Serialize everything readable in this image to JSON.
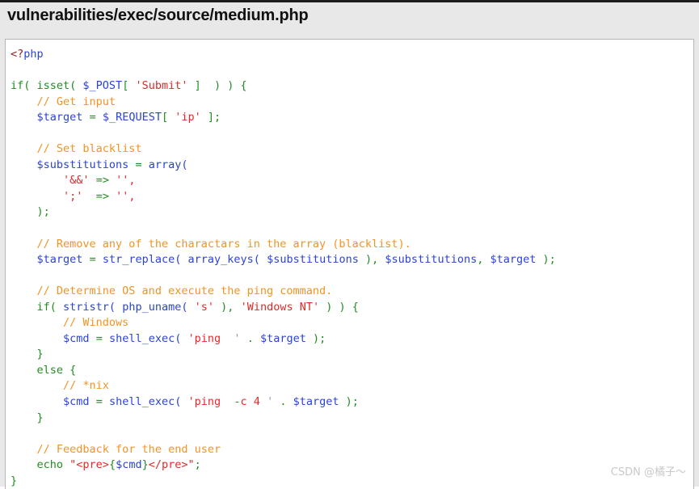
{
  "page": {
    "title": "vulnerabilities/exec/source/medium.php",
    "watermark": "CSDN @橘子～",
    "background_color": "#e8e8e8",
    "code_background_color": "#ffffff"
  },
  "colors": {
    "keyword": "#218c21",
    "variable": "#2b44d4",
    "function": "#2b44d4",
    "string": "#e02a2a",
    "comment": "#f39324",
    "tag": "#8a1f1f",
    "plain": "#333333"
  },
  "code": {
    "language": "php",
    "lines": [
      {
        "n": 1,
        "text": "<?php"
      },
      {
        "n": 2,
        "text": ""
      },
      {
        "n": 3,
        "text": "if( isset( $_POST[ 'Submit' ]  ) ) {"
      },
      {
        "n": 4,
        "text": "    // Get input"
      },
      {
        "n": 5,
        "text": "    $target = $_REQUEST[ 'ip' ];"
      },
      {
        "n": 6,
        "text": ""
      },
      {
        "n": 7,
        "text": "    // Set blacklist"
      },
      {
        "n": 8,
        "text": "    $substitutions = array("
      },
      {
        "n": 9,
        "text": "        '&&' => '',"
      },
      {
        "n": 10,
        "text": "        ';'  => '',"
      },
      {
        "n": 11,
        "text": "    );"
      },
      {
        "n": 12,
        "text": ""
      },
      {
        "n": 13,
        "text": "    // Remove any of the charactars in the array (blacklist)."
      },
      {
        "n": 14,
        "text": "    $target = str_replace( array_keys( $substitutions ), $substitutions, $target );"
      },
      {
        "n": 15,
        "text": ""
      },
      {
        "n": 16,
        "text": "    // Determine OS and execute the ping command."
      },
      {
        "n": 17,
        "text": "    if( stristr( php_uname( 's' ), 'Windows NT' ) ) {"
      },
      {
        "n": 18,
        "text": "        // Windows"
      },
      {
        "n": 19,
        "text": "        $cmd = shell_exec( 'ping  ' . $target );"
      },
      {
        "n": 20,
        "text": "    }"
      },
      {
        "n": 21,
        "text": "    else {"
      },
      {
        "n": 22,
        "text": "        // *nix"
      },
      {
        "n": 23,
        "text": "        $cmd = shell_exec( 'ping  -c 4 ' . $target );"
      },
      {
        "n": 24,
        "text": "    }"
      },
      {
        "n": 25,
        "text": ""
      },
      {
        "n": 26,
        "text": "    // Feedback for the end user"
      },
      {
        "n": 27,
        "text": "    echo \"<pre>{$cmd}</pre>\";"
      },
      {
        "n": 28,
        "text": "}"
      }
    ]
  }
}
